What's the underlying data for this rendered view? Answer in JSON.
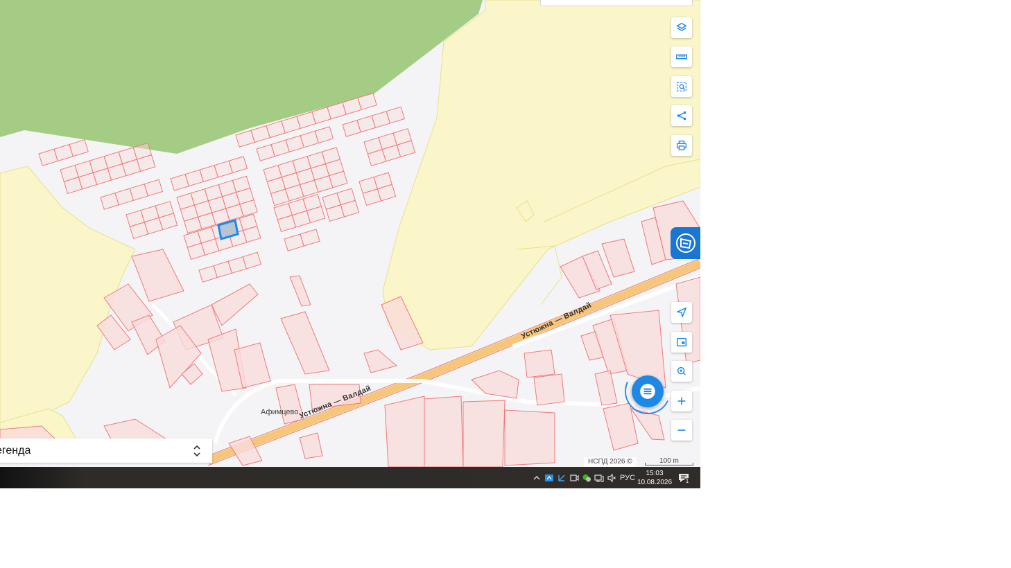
{
  "map": {
    "place_label": "Афимцево",
    "road_label_1": "Устюжна — Валдай",
    "road_label_2": "Устюжна — Валдай",
    "attribution": "НСПД 2026 ©",
    "scale_label": "100 m",
    "colors": {
      "forest": "#a5cc84",
      "zone": "#faf6c9",
      "zone_border": "#e8e08a",
      "background": "#f4f4f6",
      "parcel_fill": "#f9dcdc",
      "parcel_stroke": "#ef7a7a",
      "road": "#f6c77a",
      "selected_fill": "#b8c4d2",
      "selected_stroke": "#1e88e5",
      "accent": "#1e88e5"
    }
  },
  "toolbar": {
    "buttons": [
      {
        "name": "layers-button",
        "icon": "layers-icon"
      },
      {
        "name": "ruler-button",
        "icon": "ruler-icon"
      },
      {
        "name": "area-select-button",
        "icon": "select-search-icon"
      },
      {
        "name": "share-button",
        "icon": "share-icon"
      },
      {
        "name": "print-button",
        "icon": "printer-icon"
      }
    ]
  },
  "nav_controls": {
    "buttons": [
      {
        "name": "locate-button",
        "icon": "navigation-arrow-icon"
      },
      {
        "name": "minimap-button",
        "icon": "picture-in-picture-icon"
      },
      {
        "name": "geosearch-button",
        "icon": "target-pin-icon"
      },
      {
        "name": "zoom-in-button",
        "icon": "plus-icon"
      },
      {
        "name": "zoom-out-button",
        "icon": "minus-icon"
      }
    ]
  },
  "legend": {
    "label": "егенда",
    "icon": "chevron-up-down-icon"
  },
  "side_tab": {
    "icon": "folded-map-icon"
  },
  "chat": {
    "icon": "chat-lines-icon"
  },
  "taskbar": {
    "language": "РУС",
    "time": "15:03",
    "date": "10.08.2026",
    "notification_count": "1",
    "tray_icons": [
      "chevron-up-icon",
      "app-blue-icon",
      "app-pen-icon",
      "camera-icon",
      "wechat-icon",
      "network-icon",
      "volume-muted-icon"
    ]
  }
}
